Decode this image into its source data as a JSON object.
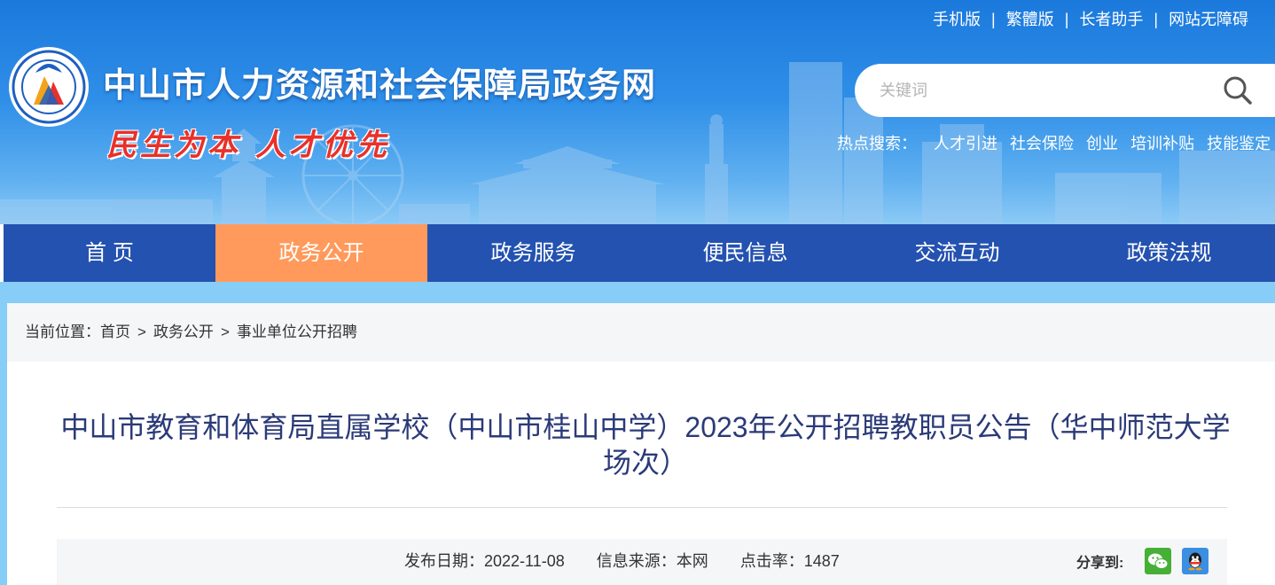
{
  "header": {
    "toplinks": [
      "手机版",
      "繁體版",
      "长者助手",
      "网站无障碍"
    ],
    "toplink_separator": "|",
    "site_title": "中山市人力资源和社会保障局政务网",
    "slogan": "民生为本 人才优先",
    "search": {
      "placeholder": "关键词"
    },
    "hot_label": "热点搜索：",
    "hot_items": [
      "人才引进",
      "社会保险",
      "创业",
      "培训补贴",
      "技能鉴定"
    ]
  },
  "nav": {
    "items": [
      "首 页",
      "政务公开",
      "政务服务",
      "便民信息",
      "交流互动",
      "政策法规"
    ],
    "active_index": 1
  },
  "breadcrumb": {
    "label": "当前位置：",
    "items": [
      "首页",
      "政务公开",
      "事业单位公开招聘"
    ],
    "separator": ">"
  },
  "article": {
    "title": "中山市教育和体育局直属学校（中山市桂山中学）2023年公开招聘教职员公告（华中师范大学场次）",
    "publish_date": "发布日期：2022-11-08",
    "source": "信息来源：本网",
    "clicks": "点击率：1487",
    "share_label": "分享到:"
  },
  "colors": {
    "nav_bg": "#2452b0",
    "nav_active": "#ff9a5c",
    "title_text": "#2b3a78",
    "band": "#86cdf7",
    "slogan": "#e8312a"
  },
  "icons": [
    "search-icon",
    "wechat-icon",
    "qq-icon",
    "logo-emblem"
  ]
}
